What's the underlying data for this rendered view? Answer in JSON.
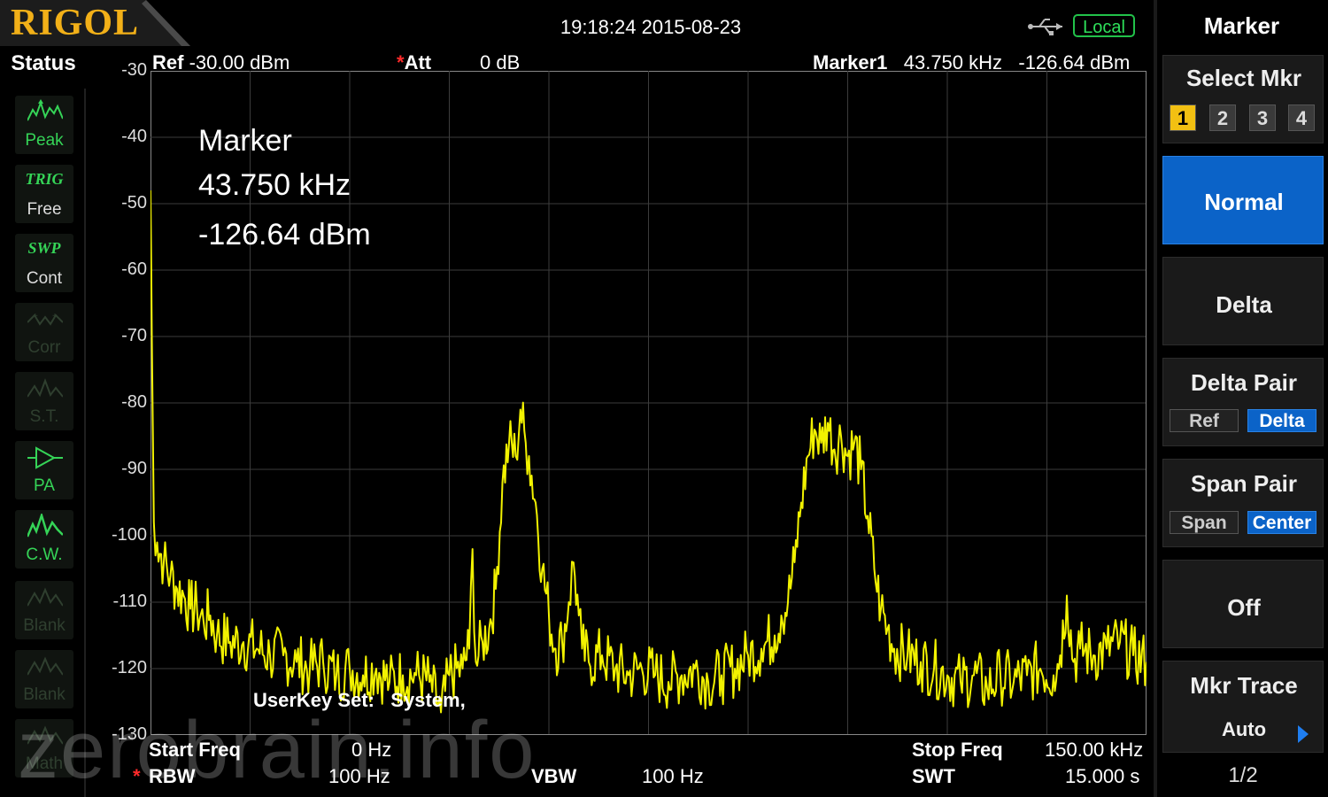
{
  "header": {
    "brand": "RIGOL",
    "datetime": "19:18:24 2015-08-23",
    "remote_state": "Local",
    "usb_icon": "usb-icon"
  },
  "status": {
    "title": "Status",
    "items": [
      {
        "name": "peak",
        "top": "",
        "label": "Peak",
        "active": true,
        "icon": "peak-icon"
      },
      {
        "name": "trig",
        "top": "TRIG",
        "label": "Free",
        "active": true,
        "icon": ""
      },
      {
        "name": "swp",
        "top": "SWP",
        "label": "Cont",
        "active": true,
        "icon": ""
      },
      {
        "name": "corr",
        "top": "",
        "label": "Corr",
        "active": false,
        "icon": "corr-icon"
      },
      {
        "name": "st",
        "top": "",
        "label": "S.T.",
        "active": false,
        "icon": "st-icon"
      },
      {
        "name": "pa",
        "top": "",
        "label": "PA",
        "active": true,
        "icon": "pa-icon"
      },
      {
        "name": "cw",
        "top": "",
        "label": "C.W.",
        "active": true,
        "icon": "cw-icon"
      },
      {
        "name": "blank1",
        "top": "",
        "label": "Blank",
        "active": false,
        "icon": "blank-icon"
      },
      {
        "name": "blank2",
        "top": "",
        "label": "Blank",
        "active": false,
        "icon": "blank-icon"
      },
      {
        "name": "math",
        "top": "",
        "label": "Math",
        "active": false,
        "icon": "math-icon"
      }
    ]
  },
  "measurement": {
    "ref_label": "Ref",
    "ref_value": "-30.00 dBm",
    "att_label": "Att",
    "att_value": "0 dB",
    "marker_label": "Marker1",
    "marker_freq": "43.750 kHz",
    "marker_amp": "-126.64 dBm"
  },
  "marker_box": {
    "title": "Marker",
    "freq": "43.750 kHz",
    "amp": "-126.64 dBm"
  },
  "userkey": {
    "label": "UserKey Set:",
    "value": "System,"
  },
  "footer": {
    "start_label": "Start Freq",
    "start_value": "0 Hz",
    "rbw_label": "RBW",
    "rbw_value": "100 Hz",
    "vbw_label": "VBW",
    "vbw_value": "100 Hz",
    "stop_label": "Stop Freq",
    "stop_value": "150.00 kHz",
    "swt_label": "SWT",
    "swt_value": "15.000 s"
  },
  "watermark": "zerobrain.info",
  "menu": {
    "title": "Marker",
    "select_mkr": "Select Mkr",
    "mkr_numbers": [
      "1",
      "2",
      "3",
      "4"
    ],
    "selected_mkr": "1",
    "normal": "Normal",
    "delta": "Delta",
    "delta_pair": "Delta Pair",
    "delta_pair_opts": [
      "Ref",
      "Delta"
    ],
    "delta_pair_selected": "Delta",
    "span_pair": "Span Pair",
    "span_pair_opts": [
      "Span",
      "Center"
    ],
    "span_pair_selected": "Center",
    "off": "Off",
    "mkr_trace": "Mkr Trace",
    "mkr_trace_value": "Auto",
    "page": "1/2"
  },
  "colors": {
    "trace": "#f2f200",
    "grid": "#3c3c3c",
    "accent": "#0b63c8",
    "status_on": "#35d457",
    "brand": "#f2b018"
  },
  "chart_data": {
    "type": "line",
    "xlim": [
      0,
      150
    ],
    "ylim": [
      -130,
      -30
    ],
    "y_ticks": [
      "-30",
      "-40",
      "-50",
      "-60",
      "-70",
      "-80",
      "-90",
      "-100",
      "-110",
      "-120",
      "-130"
    ],
    "x_unit": "kHz",
    "y_unit": "dBm",
    "grid": true,
    "series": [
      {
        "points": [
          [
            0,
            -48
          ],
          [
            0.2,
            -70
          ],
          [
            0.5,
            -98
          ],
          [
            1,
            -101
          ],
          [
            2,
            -104
          ],
          [
            3,
            -106
          ],
          [
            4,
            -108
          ],
          [
            5,
            -109
          ],
          [
            6,
            -111
          ],
          [
            7,
            -111
          ],
          [
            8,
            -113
          ],
          [
            9,
            -112
          ],
          [
            10,
            -115
          ],
          [
            12,
            -116
          ],
          [
            14,
            -116
          ],
          [
            16,
            -117
          ],
          [
            18,
            -118
          ],
          [
            20,
            -118
          ],
          [
            22,
            -119
          ],
          [
            24,
            -120
          ],
          [
            26,
            -119
          ],
          [
            28,
            -121
          ],
          [
            30,
            -120
          ],
          [
            32,
            -121
          ],
          [
            34,
            -120
          ],
          [
            36,
            -122
          ],
          [
            38,
            -121
          ],
          [
            40,
            -121
          ],
          [
            42,
            -122
          ],
          [
            43.75,
            -126.6
          ],
          [
            45,
            -121
          ],
          [
            47,
            -120
          ],
          [
            48,
            -117
          ],
          [
            48.5,
            -102
          ],
          [
            49,
            -119
          ],
          [
            50,
            -116
          ],
          [
            51,
            -114
          ],
          [
            52,
            -108
          ],
          [
            53,
            -92
          ],
          [
            54,
            -86
          ],
          [
            55,
            -88
          ],
          [
            55.7,
            -81
          ],
          [
            56.5,
            -86
          ],
          [
            57,
            -88
          ],
          [
            58,
            -95
          ],
          [
            59,
            -105
          ],
          [
            60,
            -112
          ],
          [
            61,
            -117
          ],
          [
            62,
            -116
          ],
          [
            63,
            -110
          ],
          [
            63.7,
            -104
          ],
          [
            64.5,
            -112
          ],
          [
            65,
            -117
          ],
          [
            66,
            -119
          ],
          [
            68,
            -118
          ],
          [
            70,
            -120
          ],
          [
            72,
            -121
          ],
          [
            74,
            -120
          ],
          [
            76,
            -121
          ],
          [
            78,
            -122
          ],
          [
            80,
            -121
          ],
          [
            82,
            -120
          ],
          [
            84,
            -122
          ],
          [
            86,
            -121
          ],
          [
            88,
            -120
          ],
          [
            90,
            -118
          ],
          [
            92,
            -117
          ],
          [
            94,
            -115
          ],
          [
            95,
            -112
          ],
          [
            96,
            -110
          ],
          [
            97,
            -104
          ],
          [
            98,
            -95
          ],
          [
            99,
            -88
          ],
          [
            100,
            -84
          ],
          [
            101,
            -86
          ],
          [
            102,
            -83
          ],
          [
            103,
            -87
          ],
          [
            104,
            -85
          ],
          [
            105,
            -88
          ],
          [
            106,
            -86
          ],
          [
            107,
            -90
          ],
          [
            108,
            -97
          ],
          [
            109,
            -105
          ],
          [
            110,
            -111
          ],
          [
            111,
            -114
          ],
          [
            112,
            -117
          ],
          [
            114,
            -118
          ],
          [
            116,
            -119
          ],
          [
            118,
            -120
          ],
          [
            120,
            -121
          ],
          [
            122,
            -122
          ],
          [
            124,
            -121
          ],
          [
            126,
            -123
          ],
          [
            128,
            -121
          ],
          [
            130,
            -122
          ],
          [
            132,
            -121
          ],
          [
            134,
            -120
          ],
          [
            136,
            -121
          ],
          [
            137,
            -118
          ],
          [
            138,
            -109
          ],
          [
            139,
            -119
          ],
          [
            140,
            -117
          ],
          [
            142,
            -118
          ],
          [
            144,
            -117
          ],
          [
            146,
            -116
          ],
          [
            148,
            -118
          ],
          [
            150,
            -119
          ]
        ]
      }
    ]
  }
}
